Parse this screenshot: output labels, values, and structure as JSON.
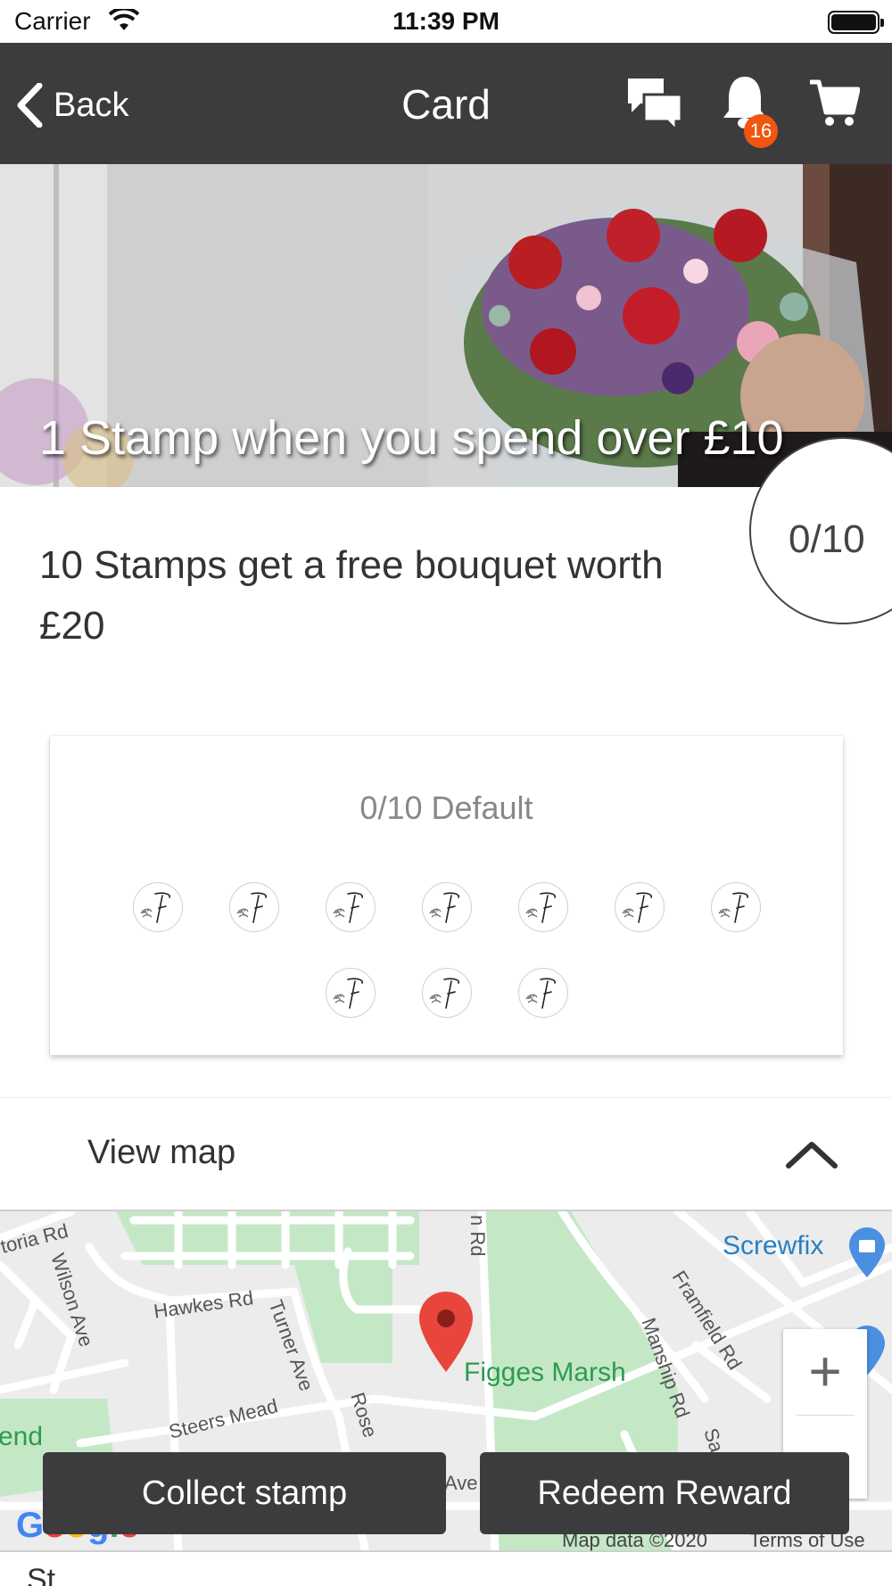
{
  "status_bar": {
    "carrier": "Carrier",
    "time": "11:39 PM"
  },
  "nav": {
    "back_label": "Back",
    "title": "Card",
    "notification_count": "16",
    "icons": [
      "chevron-left-icon",
      "chat-icon",
      "bell-icon",
      "cart-icon"
    ]
  },
  "hero": {
    "title": "1 Stamp when you spend over £10"
  },
  "progress": {
    "text": "0/10",
    "collected": 0,
    "total": 10
  },
  "reward": {
    "description": "10 Stamps get a free bouquet worth £20"
  },
  "stamp_card": {
    "title": "0/10 Default",
    "stamps_total": 10,
    "stamps_collected": 0
  },
  "view_map": {
    "label": "View map"
  },
  "map": {
    "streets": [
      "toria Rd",
      "Wilson Ave",
      "Hawkes Rd",
      "Turner Ave",
      "n Rd",
      "Framfield Rd",
      "Manship Rd",
      "Steers Mead",
      "Rose",
      "Ave",
      "Sa"
    ],
    "poi": "Screwfix",
    "park": "Figges Marsh",
    "attribution": "Map data ©2020",
    "terms": "Terms of Use",
    "logo": "Google",
    "partial_label": "end"
  },
  "actions": {
    "collect": "Collect stamp",
    "redeem": "Redeem Reward"
  },
  "bottom_peek": "St",
  "colors": {
    "nav_bg": "#3c3c3e",
    "badge": "#f0560f",
    "button_bg": "#3c3c3e",
    "park": "#c4e8c6",
    "pin": "#e8453c"
  }
}
